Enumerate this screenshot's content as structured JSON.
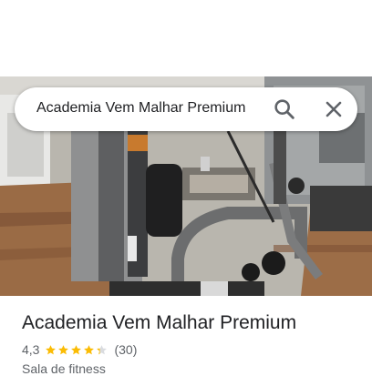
{
  "search": {
    "query": "Academia Vem Malhar Premium"
  },
  "place": {
    "name": "Academia Vem Malhar Premium",
    "rating": "4,3",
    "rating_value": 4.3,
    "reviews_count": "(30)",
    "category": "Sala de fitness"
  },
  "icons": {
    "search": "search-icon",
    "close": "close-icon",
    "star": "star-icon"
  },
  "colors": {
    "star": "#fbbc04",
    "star_empty": "#dadce0",
    "title_text": "#202124",
    "secondary_text": "#5f6368"
  }
}
